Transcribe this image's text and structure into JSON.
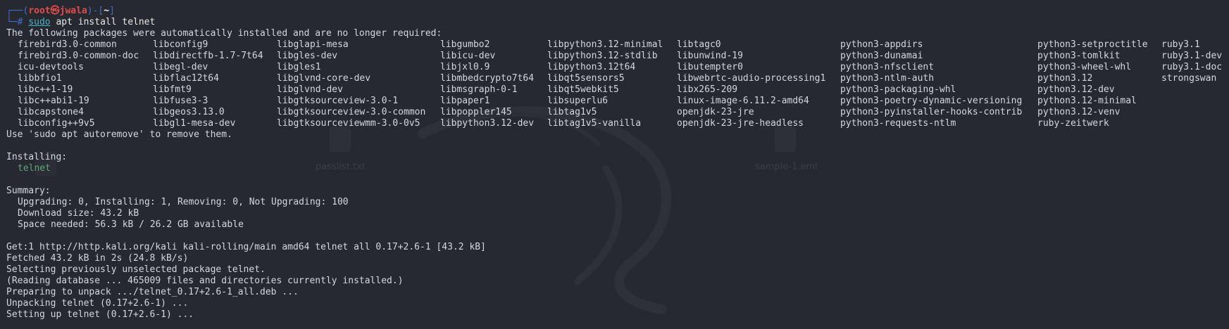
{
  "prompt": {
    "frame_top_left": "┌──(",
    "user": "root",
    "at_symbol": "㉿",
    "host": "jwala",
    "frame_mid": ")-[",
    "path": "~",
    "frame_end": "]",
    "frame_bottom": "└─",
    "hash": "#",
    "cmd_sudo": "sudo",
    "cmd_rest": " apt install telnet"
  },
  "output": {
    "auto_installed_header": "The following packages were automatically installed and are no longer required:",
    "package_columns": [
      [
        "firebird3.0-common",
        "firebird3.0-common-doc",
        "icu-devtools",
        "libbfio1",
        "libc++1-19",
        "libc++abi1-19",
        "libcapstone4",
        "libconfig++9v5"
      ],
      [
        "libconfig9",
        "libdirectfb-1.7-7t64",
        "libegl-dev",
        "libflac12t64",
        "libfmt9",
        "libfuse3-3",
        "libgeos3.13.0",
        "libgl1-mesa-dev"
      ],
      [
        "libglapi-mesa",
        "libgles-dev",
        "libgles1",
        "libglvnd-core-dev",
        "libglvnd-dev",
        "libgtksourceview-3.0-1",
        "libgtksourceview-3.0-common",
        "libgtksourceviewmm-3.0-0v5"
      ],
      [
        "libgumbo2",
        "libicu-dev",
        "libjxl0.9",
        "libmbedcrypto7t64",
        "libmsgraph-0-1",
        "libpaper1",
        "libpoppler145",
        "libpython3.12-dev"
      ],
      [
        "libpython3.12-minimal",
        "libpython3.12-stdlib",
        "libpython3.12t64",
        "libqt5sensors5",
        "libqt5webkit5",
        "libsuperlu6",
        "libtag1v5",
        "libtag1v5-vanilla"
      ],
      [
        "libtagc0",
        "libunwind-19",
        "libutempter0",
        "libwebrtc-audio-processing1",
        "libx265-209",
        "linux-image-6.11.2-amd64",
        "openjdk-23-jre",
        "openjdk-23-jre-headless"
      ],
      [
        "python3-appdirs",
        "python3-dunamai",
        "python3-nfsclient",
        "python3-ntlm-auth",
        "python3-packaging-whl",
        "python3-poetry-dynamic-versioning",
        "python3-pyinstaller-hooks-contrib",
        "python3-requests-ntlm"
      ],
      [
        "python3-setproctitle",
        "python3-tomlkit",
        "python3-wheel-whl",
        "python3.12",
        "python3.12-dev",
        "python3.12-minimal",
        "python3.12-venv",
        "ruby-zeitwerk"
      ],
      [
        "ruby3.1",
        "ruby3.1-dev",
        "ruby3.1-doc",
        "strongswan"
      ]
    ],
    "autoremove_hint": "Use 'sudo apt autoremove' to remove them.",
    "installing_header": "Installing:",
    "installing_pkg": "telnet",
    "summary_header": "Summary:",
    "summary_counts": "Upgrading: 0, Installing: 1, Removing: 0, Not Upgrading: 100",
    "download_size": "Download size: 43.2 kB",
    "space_needed": "Space needed: 56.3 kB / 26.2 GB available",
    "get_line": "Get:1 http://http.kali.org/kali kali-rolling/main amd64 telnet all 0.17+2.6-1 [43.2 kB]",
    "fetched_line": "Fetched 43.2 kB in 2s (24.8 kB/s)",
    "selecting_line": "Selecting previously unselected package telnet.",
    "reading_db_line": "(Reading database ... 465009 files and directories currently installed.)",
    "preparing_line": "Preparing to unpack .../telnet_0.17+2.6-1_all.deb ...",
    "unpacking_line": "Unpacking telnet (0.17+2.6-1) ...",
    "setting_up_line": "Setting up telnet (0.17+2.6-1) ..."
  },
  "background": {
    "file_left": "passlist.txt",
    "file_right": "sample-1.eml"
  },
  "colors": {
    "terminal_bg": "#262930",
    "prompt_frame": "#3e6fd0",
    "prompt_user_host": "#e24c4c",
    "sudo_highlight": "#46b6c6",
    "installing_pkg": "#5fa77a"
  }
}
